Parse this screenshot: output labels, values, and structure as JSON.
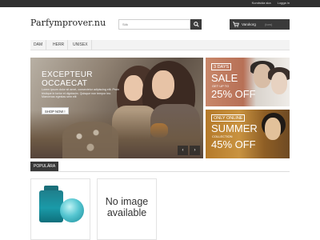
{
  "top_links": {
    "create_account": "Kundsida ska",
    "login": "Logga in"
  },
  "site": {
    "logo": "Parfymprover.nu"
  },
  "search": {
    "placeholder": "Sök"
  },
  "cart": {
    "label": "Varukorg",
    "count": "(tom)"
  },
  "nav": {
    "items": [
      "DAM",
      "HERR",
      "UNISEX"
    ]
  },
  "hero": {
    "title_line1": "EXCEPTEUR",
    "title_line2": "OCCAECAT",
    "text": "Lorem ipsum dolor sit amet, consectetur adipiscing elit. Proin tristique in tortor et dignissim. Quisque non tempor leo. Maecenas egestas sem elit",
    "button": "SHOP NOW !",
    "prev": "‹",
    "next": "›"
  },
  "promo1": {
    "tag": "3 DAYS",
    "big": "SALE",
    "small": "GET UP TO",
    "pct": "25% OFF"
  },
  "promo2": {
    "tag": "ONLY ONLINE",
    "big": "SUMMER",
    "small": "COLLECTION",
    "pct": "45% OFF"
  },
  "popular": {
    "label": "POPULÄRA"
  },
  "products": [
    {
      "image": "perfume-bottle"
    },
    {
      "no_image": "No image available"
    }
  ]
}
